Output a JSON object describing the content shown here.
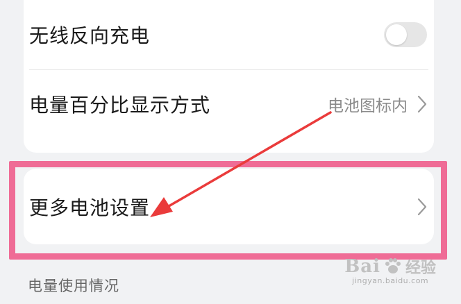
{
  "settings": {
    "wireless_reverse_charge": {
      "label": "无线反向充电",
      "enabled": false
    },
    "battery_percentage_style": {
      "label": "电量百分比显示方式",
      "value": "电池图标内"
    },
    "more_battery_settings": {
      "label": "更多电池设置"
    },
    "usage_section_header": "电量使用情况"
  },
  "annotation": {
    "highlight_color": "#ef6c96",
    "arrow_color": "#ea3b3b"
  },
  "watermark": {
    "brand": "Bai",
    "brand_cn": "经验",
    "url": "jingyan.baidu.com"
  }
}
